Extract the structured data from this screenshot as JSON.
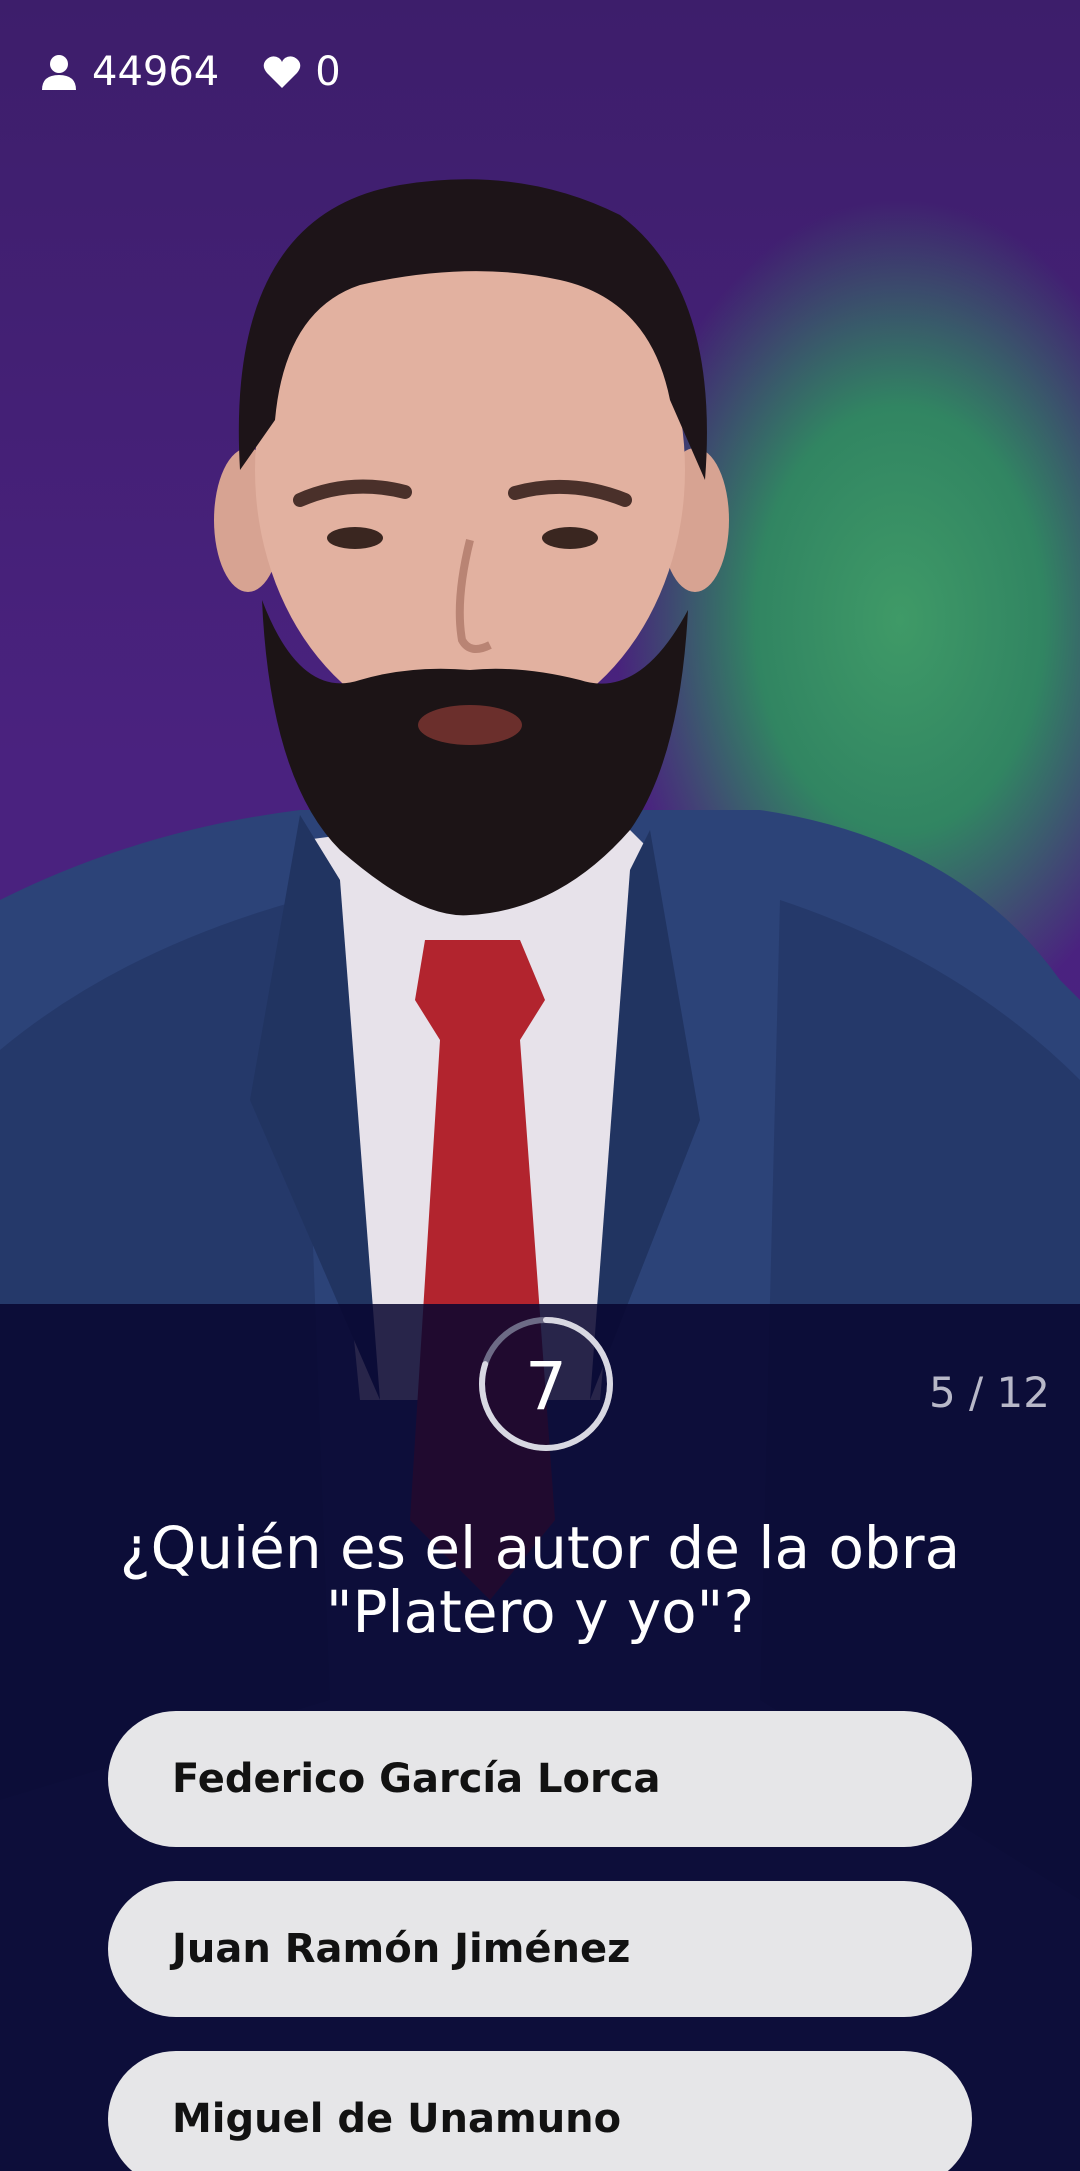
{
  "stats": {
    "viewers_icon": "person-icon",
    "viewers": "44964",
    "likes_icon": "heart-icon",
    "likes": "0"
  },
  "timer": {
    "value": "7",
    "remaining_fraction": 0.8
  },
  "progress": "5 / 12",
  "question": {
    "line1": "¿Quién es el autor de la obra",
    "line2": "\"Platero y yo\"?"
  },
  "answers": [
    {
      "label": "Federico García Lorca"
    },
    {
      "label": "Juan Ramón Jiménez"
    },
    {
      "label": "Miguel de Unamuno"
    }
  ],
  "colors": {
    "background_purple": "#4a227f",
    "background_green": "#3f9a67",
    "panel": "#080630",
    "answer_fill": "#e6e6e8",
    "answer_text": "#121212",
    "progress_text": "#b8b8c8"
  }
}
